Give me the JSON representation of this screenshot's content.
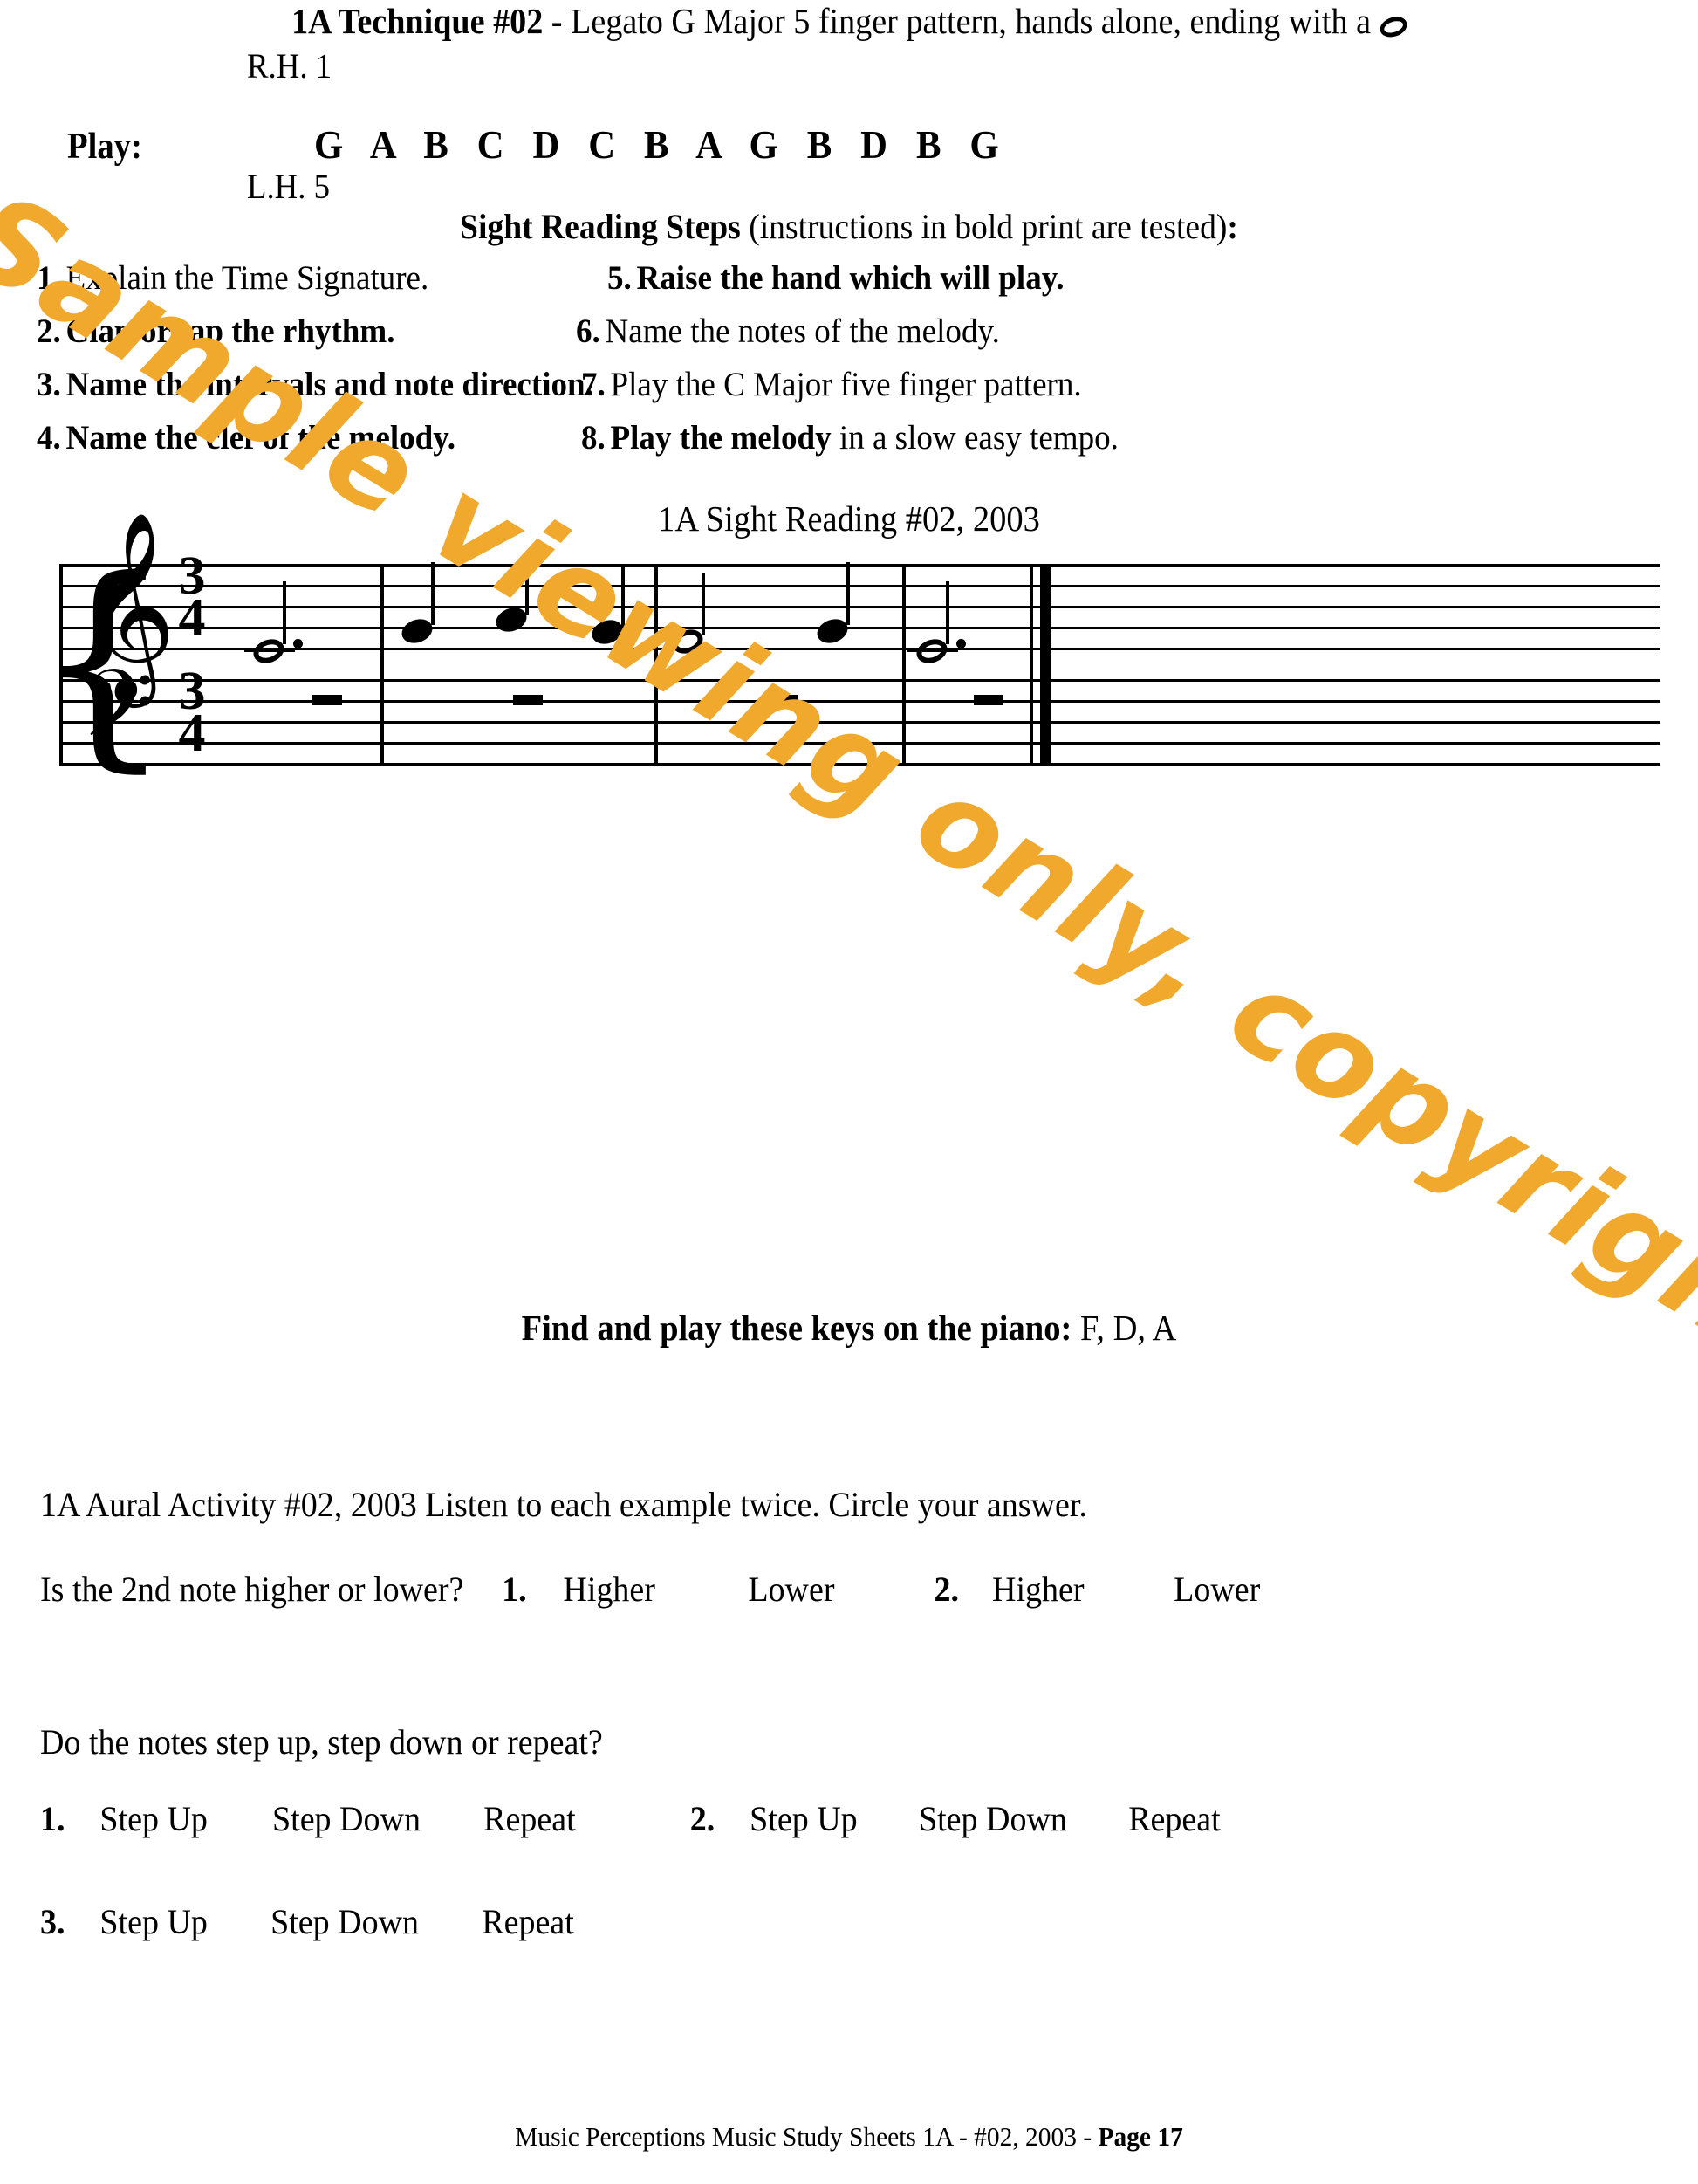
{
  "technique": {
    "bold_lead": "1A Technique #02 -",
    "rest": " Legato G Major 5 finger pattern, hands alone, ending with a",
    "ending_note_icon": "whole-note-icon"
  },
  "play_block": {
    "rh_label": "R.H. 1",
    "play_label": "Play:",
    "note_letters": "G A B C D C B A G B D B G",
    "lh_label": "L.H. 5"
  },
  "sight_reading": {
    "heading_bold": "Sight Reading Steps",
    "heading_rest": " (instructions in bold print are tested)",
    "heading_colon": ":",
    "steps": [
      {
        "num": "1.",
        "text": "Explain the Time Signature.",
        "bold": false
      },
      {
        "num": "2.",
        "text": "Clap or tap the rhythm.",
        "bold": true
      },
      {
        "num": "3.",
        "text": "Name the intervals and note direction.",
        "bold": true
      },
      {
        "num": "4.",
        "text": "Name the clef of the melody.",
        "bold": true
      },
      {
        "num": "5.",
        "text": "Raise the hand which will play.",
        "bold": true
      },
      {
        "num": "6.",
        "text": "Name the notes of the melody.",
        "bold": false
      },
      {
        "num": "7.",
        "text": "Play the C Major five finger pattern.",
        "bold": false
      },
      {
        "num": "8.",
        "bold_part": "Play the melody",
        "text": " in a slow easy tempo.",
        "bold": false
      }
    ]
  },
  "score": {
    "title": "1A Sight Reading #02, 2003",
    "treble_clef": "𝄞",
    "bass_clef": "𝄢",
    "brace": "{",
    "time_signature_top": "3",
    "time_signature_bottom": "4",
    "measures": [
      {
        "treble": "dotted half note C (ledger line)",
        "bass": "half rest"
      },
      {
        "treble": "quarter notes E, F, E",
        "bass": "half rest"
      },
      {
        "treble": "half note D, quarter note E",
        "bass": "half rest"
      },
      {
        "treble": "dotted half note C (ledger line)",
        "bass": "half rest"
      }
    ]
  },
  "find_keys": {
    "bold": "Find and play these keys on the piano:",
    "keys": " F,  D,  A"
  },
  "aural": {
    "intro": "1A Aural Activity #02, 2003  Listen to each example twice.  Circle your answer.",
    "question1": "Is the 2nd note higher or lower?",
    "q1_items": [
      {
        "num": "1.",
        "options": [
          "Higher",
          "Lower"
        ]
      },
      {
        "num": "2.",
        "options": [
          "Higher",
          "Lower"
        ]
      }
    ],
    "question2": "Do the notes step up, step down or repeat?",
    "q2_items": [
      {
        "num": "1.",
        "options": [
          "Step Up",
          "Step Down",
          "Repeat"
        ]
      },
      {
        "num": "2.",
        "options": [
          "Step Up",
          "Step Down",
          "Repeat"
        ]
      },
      {
        "num": "3.",
        "options": [
          "Step Up",
          "Step Down",
          "Repeat"
        ]
      }
    ]
  },
  "footer": {
    "text": "Music Perceptions Music Study Sheets 1A - #02, 2003 - ",
    "page_label": "Page 17"
  },
  "watermark": {
    "text": "Sample viewing only, copyrighted material.",
    "color": "#F0A92C"
  }
}
